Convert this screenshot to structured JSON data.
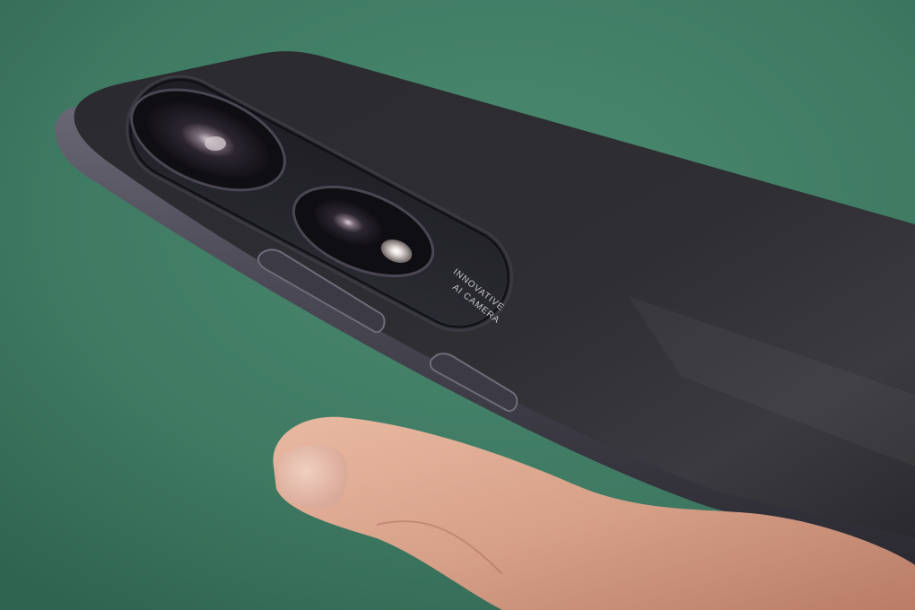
{
  "photo": {
    "subject": "smartphone-back-held-in-hand",
    "background_color": "#3f7a63",
    "phone_color": "#2b2b30",
    "frame_color": "#4a4854",
    "skin_color": "#d7a088"
  },
  "camera_module": {
    "engraving_line_1": "INNOVATIVE",
    "engraving_line_2": "AI CAMERA"
  }
}
